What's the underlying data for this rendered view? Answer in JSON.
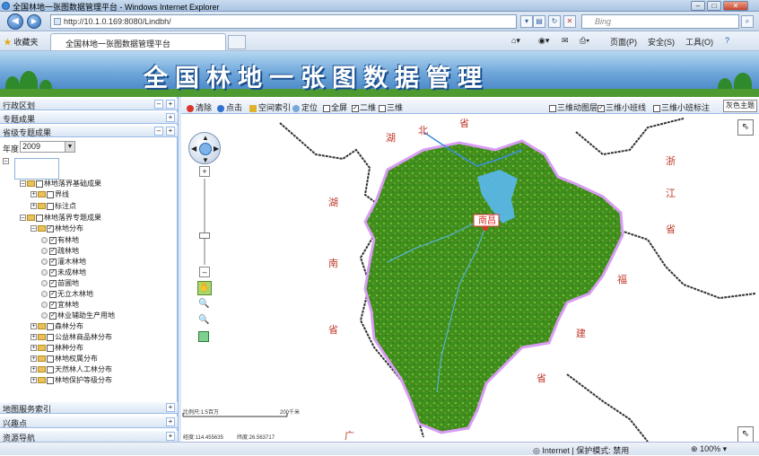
{
  "window": {
    "title": "全国林地一张图数据管理平台 - Windows Internet Explorer"
  },
  "address": {
    "url": "http://10.1.0.169:8080/Lindbh/",
    "search_placeholder": "Bing"
  },
  "favorites": {
    "label": "收藏夹",
    "tab_title": "全国林地一张图数据管理平台"
  },
  "commands": {
    "page": "页面(P)",
    "safety": "安全(S)",
    "tools": "工具(O)",
    "help": "?"
  },
  "banner": {
    "title": "全国林地一张图数据管理"
  },
  "sidebar": {
    "panels_top": [
      "行政区划",
      "专题成果",
      "省级专题成果"
    ],
    "year_label": "年度",
    "year_value": "2009",
    "tree": [
      {
        "label": "林地落界基础成果",
        "level": 1,
        "expanded": true,
        "checked": false,
        "folder": true
      },
      {
        "label": "界线",
        "level": 2,
        "expanded": false,
        "checked": false,
        "folder": true
      },
      {
        "label": "标注点",
        "level": 2,
        "expanded": false,
        "checked": false,
        "folder": true
      },
      {
        "label": "林地落界专题成果",
        "level": 1,
        "expanded": true,
        "checked": false,
        "folder": true
      },
      {
        "label": "林地分布",
        "level": 2,
        "expanded": true,
        "checked": true,
        "folder": true
      },
      {
        "label": "有林地",
        "level": 3,
        "checked": true
      },
      {
        "label": "疏林地",
        "level": 3,
        "checked": true
      },
      {
        "label": "灌木林地",
        "level": 3,
        "checked": true
      },
      {
        "label": "未成林地",
        "level": 3,
        "checked": true
      },
      {
        "label": "苗圃地",
        "level": 3,
        "checked": true
      },
      {
        "label": "无立木林地",
        "level": 3,
        "checked": true
      },
      {
        "label": "宜林地",
        "level": 3,
        "checked": true
      },
      {
        "label": "林业辅助生产用地",
        "level": 3,
        "checked": true
      },
      {
        "label": "森林分布",
        "level": 2,
        "expanded": false,
        "checked": false,
        "folder": true
      },
      {
        "label": "公益林商品林分布",
        "level": 2,
        "expanded": false,
        "checked": false,
        "folder": true
      },
      {
        "label": "林种分布",
        "level": 2,
        "expanded": false,
        "checked": false,
        "folder": true
      },
      {
        "label": "林地权属分布",
        "level": 2,
        "expanded": false,
        "checked": false,
        "folder": true
      },
      {
        "label": "天然林人工林分布",
        "level": 2,
        "expanded": false,
        "checked": false,
        "folder": true
      },
      {
        "label": "林地保护等级分布",
        "level": 2,
        "expanded": false,
        "checked": false,
        "folder": true
      }
    ],
    "panels_bottom": [
      "地图服务索引",
      "兴趣点",
      "资源导航"
    ]
  },
  "toolbar": {
    "clear": "清除",
    "point": "点击",
    "spatial_index": "空间索引",
    "locate": "定位",
    "fullscreen": "全屏",
    "twod": "二维",
    "threed": "三维",
    "layer3d": "三维动图层",
    "small_class_3d": "三维小班线",
    "small_class_label": "三维小班标注",
    "theme": "灰色主题"
  },
  "map": {
    "province_labels": {
      "hubei": [
        "湖",
        "北",
        "省"
      ],
      "hunan": [
        "湖",
        "南",
        "省"
      ],
      "zhejiang": [
        "浙",
        "江",
        "省"
      ],
      "fujian": [
        "福",
        "建",
        "省"
      ],
      "guangdong": "广"
    },
    "capital": "南昌",
    "scale_label": "比例尺:1:5百万",
    "scale_value": "200千米",
    "coords_x": "经度:114.455635",
    "coords_y": "纬度:26.563717",
    "colors": {
      "forest": "#3f8f1d",
      "border": "#d89cf3",
      "water": "#5ab8f0"
    }
  },
  "status": {
    "zone": "Internet | 保护模式: 禁用",
    "zoom": "100%"
  }
}
